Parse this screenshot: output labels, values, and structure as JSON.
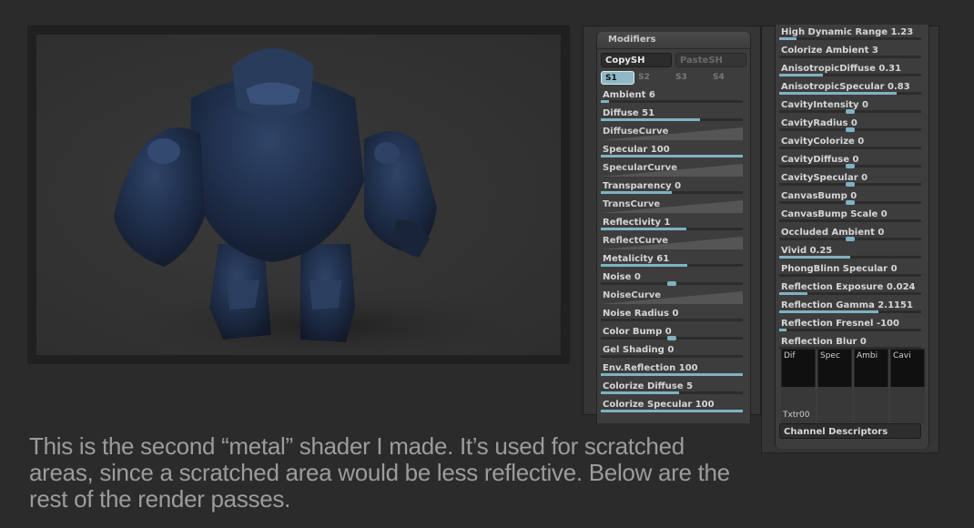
{
  "left_panel": {
    "header": "Modifiers",
    "copy_button": "CopySH",
    "paste_button": "PasteSH",
    "tabs": [
      "S1",
      "S2",
      "S3",
      "S4"
    ],
    "rows": [
      {
        "label": "Ambient 6",
        "kind": "slider",
        "value": 0.06
      },
      {
        "label": "Diffuse 51",
        "kind": "slider",
        "value": 0.7
      },
      {
        "label": "DiffuseCurve",
        "kind": "curve"
      },
      {
        "label": "Specular 100",
        "kind": "slider",
        "value": 1.0
      },
      {
        "label": "SpecularCurve",
        "kind": "curve"
      },
      {
        "label": "Transparency 0",
        "kind": "slider",
        "value": 0.5
      },
      {
        "label": "TransCurve",
        "kind": "curve"
      },
      {
        "label": "Reflectivity 1",
        "kind": "slider",
        "value": 0.6
      },
      {
        "label": "ReflectCurve",
        "kind": "curve"
      },
      {
        "label": "Metalicity 61",
        "kind": "slider",
        "value": 0.61
      },
      {
        "label": "Noise 0",
        "kind": "knob",
        "value": 0.5
      },
      {
        "label": "NoiseCurve",
        "kind": "curve"
      },
      {
        "label": "Noise Radius 0",
        "kind": "plain"
      },
      {
        "label": "Color Bump 0",
        "kind": "knob",
        "value": 0.5
      },
      {
        "label": "Gel Shading 0",
        "kind": "plain"
      },
      {
        "label": "Env.Reflection 100",
        "kind": "slider",
        "value": 1.0
      },
      {
        "label": "Colorize Diffuse 5",
        "kind": "slider",
        "value": 0.55
      },
      {
        "label": "Colorize Specular 100",
        "kind": "slider",
        "value": 1.0
      }
    ]
  },
  "right_panel": {
    "rows": [
      {
        "label": "High Dynamic Range 1.23",
        "kind": "slider",
        "value": 0.12
      },
      {
        "label": "Colorize Ambient 3",
        "kind": "plain"
      },
      {
        "label": "AnisotropicDiffuse 0.31",
        "kind": "slider",
        "value": 0.31
      },
      {
        "label": "AnisotropicSpecular 0.83",
        "kind": "slider",
        "value": 0.83
      },
      {
        "label": "CavityIntensity 0",
        "kind": "knob",
        "value": 0.5
      },
      {
        "label": "CavityRadius 0",
        "kind": "knob",
        "value": 0.5
      },
      {
        "label": "CavityColorize 0",
        "kind": "plain"
      },
      {
        "label": "CavityDiffuse 0",
        "kind": "knob",
        "value": 0.5
      },
      {
        "label": "CavitySpecular 0",
        "kind": "knob",
        "value": 0.5
      },
      {
        "label": "CanvasBump 0",
        "kind": "knob",
        "value": 0.5
      },
      {
        "label": "CanvasBump Scale 0",
        "kind": "plain"
      },
      {
        "label": "Occluded Ambient 0",
        "kind": "knob",
        "value": 0.5
      },
      {
        "label": "Vivid 0.25",
        "kind": "slider",
        "value": 0.5
      },
      {
        "label": "PhongBlinn Specular 0",
        "kind": "plain"
      },
      {
        "label": "Reflection Exposure 0.024",
        "kind": "slider",
        "value": 0.2
      },
      {
        "label": "Reflection Gamma 2.1151",
        "kind": "slider",
        "value": 0.7
      },
      {
        "label": "Reflection Fresnel -100",
        "kind": "slider",
        "value": 0.05
      },
      {
        "label": "Reflection Blur 0",
        "kind": "plain"
      }
    ],
    "channels": [
      "Dif",
      "Spec",
      "Ambi",
      "Cavi"
    ],
    "texture_label": "Txtr00",
    "channel_descriptors_button": "Channel Descriptors"
  },
  "caption": "This is the second “metal” shader I made. It’s used for scratched areas, since a scratched area would be less reflective. Below are the rest of the render passes.",
  "colors": {
    "background": "#2b2b2b",
    "slider_fill": "#7fb2c2",
    "model_color": "#22324e"
  }
}
